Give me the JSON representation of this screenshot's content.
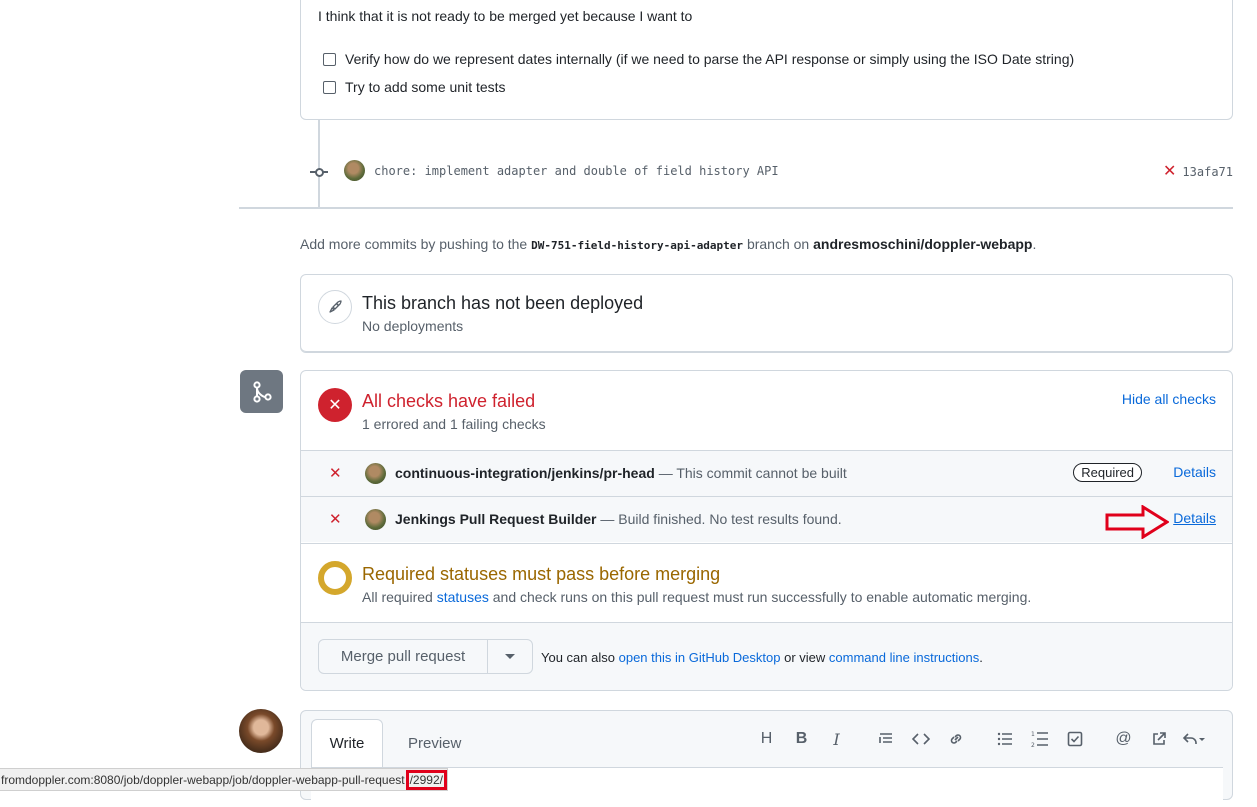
{
  "comment": {
    "text": "I think that it is not ready to be merged yet because I want to",
    "tasks": [
      {
        "label": "Verify how do we represent dates internally (if we need to parse the API response or simply using the ISO Date string)",
        "checked": false
      },
      {
        "label": "Try to add some unit tests",
        "checked": false
      }
    ]
  },
  "commit": {
    "message": "chore: implement adapter and double of field history API",
    "sha": "13afa71",
    "status": "failed"
  },
  "branch_info": {
    "prefix": "Add more commits by pushing to the",
    "branch": "DW-751-field-history-api-adapter",
    "middle": "branch on",
    "repo": "andresmoschini/doppler-webapp",
    "suffix": "."
  },
  "deployment": {
    "title": "This branch has not been deployed",
    "subtitle": "No deployments"
  },
  "checks": {
    "title": "All checks have failed",
    "subtitle": "1 errored and 1 failing checks",
    "hide_label": "Hide all checks",
    "items": [
      {
        "name": "continuous-integration/jenkins/pr-head",
        "desc": "— This commit cannot be built",
        "badge": "Required",
        "details": "Details"
      },
      {
        "name": "Jenkings Pull Request Builder",
        "desc": "— Build finished. No test results found.",
        "details": "Details"
      }
    ]
  },
  "required_status": {
    "title": "Required statuses must pass before merging",
    "sub_prefix": "All required",
    "sub_link": "statuses",
    "sub_suffix": "and check runs on this pull request must run successfully to enable automatic merging."
  },
  "merge": {
    "button_label": "Merge pull request",
    "hint_prefix": "You can also",
    "hint_link1": "open this in GitHub Desktop",
    "hint_middle": "or view",
    "hint_link2": "command line instructions",
    "hint_suffix": "."
  },
  "editor": {
    "tabs": [
      "Write",
      "Preview"
    ],
    "toolbar_icons": [
      "heading-icon",
      "bold-icon",
      "italic-icon",
      "quote-icon",
      "code-icon",
      "link-icon",
      "unordered-list-icon",
      "ordered-list-icon",
      "task-list-icon",
      "mention-icon",
      "reference-icon",
      "reply-icon"
    ]
  },
  "status_bar": {
    "url_prefix": "fromdoppler.com:8080/job/doppler-webapp/job/doppler-webapp-pull-request",
    "url_highlight": "/2992/"
  },
  "colors": {
    "danger": "#cf222e",
    "attention": "#9a6700",
    "accent": "#0969da",
    "annotation_red": "#e0001b"
  }
}
